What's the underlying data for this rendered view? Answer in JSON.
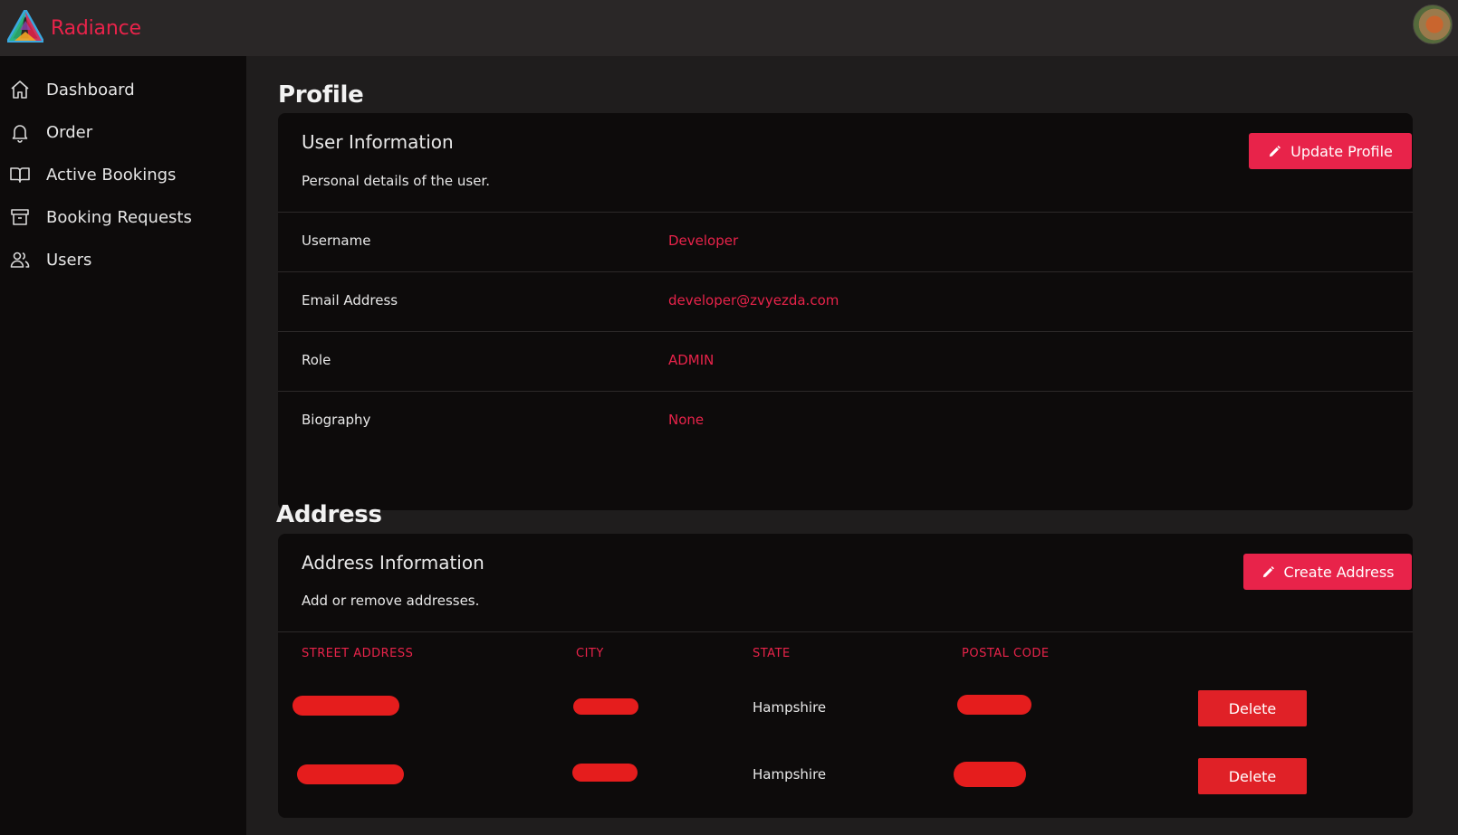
{
  "app": {
    "name": "Radiance"
  },
  "sidebar": {
    "items": [
      {
        "label": "Dashboard",
        "icon": "home-icon"
      },
      {
        "label": "Order",
        "icon": "bell-icon"
      },
      {
        "label": "Active Bookings",
        "icon": "book-open-icon"
      },
      {
        "label": "Booking Requests",
        "icon": "archive-icon"
      },
      {
        "label": "Users",
        "icon": "users-icon"
      }
    ]
  },
  "profile": {
    "section_title": "Profile",
    "card_title": "User Information",
    "card_subtitle": "Personal details of the user.",
    "update_button": "Update Profile",
    "fields": [
      {
        "label": "Username",
        "value": "Developer"
      },
      {
        "label": "Email Address",
        "value": "developer@zvyezda.com"
      },
      {
        "label": "Role",
        "value": "ADMIN"
      },
      {
        "label": "Biography",
        "value": "None"
      }
    ]
  },
  "address": {
    "section_title": "Address",
    "card_title": "Address Information",
    "card_subtitle": "Add or remove addresses.",
    "create_button": "Create Address",
    "columns": [
      "STREET ADDRESS",
      "CITY",
      "STATE",
      "POSTAL CODE"
    ],
    "rows": [
      {
        "street": "[redacted]",
        "city": "[redacted]",
        "state": "Hampshire",
        "postal_code": "[redacted]",
        "action": "Delete"
      },
      {
        "street": "[redacted]",
        "city": "[redacted]",
        "state": "Hampshire",
        "postal_code": "[redacted]",
        "action": "Delete"
      }
    ]
  },
  "colors": {
    "accent": "#e8234a",
    "sidebar_bg": "#0d0b0b",
    "page_bg": "#1f1d1d",
    "topbar_bg": "#2a2727"
  }
}
